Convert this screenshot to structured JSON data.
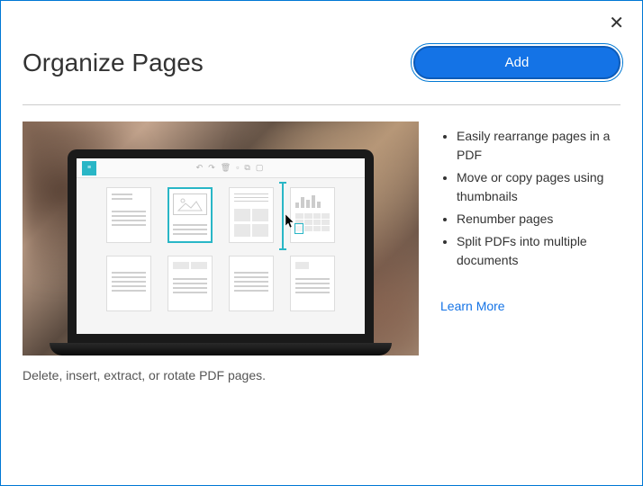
{
  "header": {
    "title": "Organize Pages",
    "add_button": "Add"
  },
  "caption": "Delete, insert, extract, or rotate PDF pages.",
  "features": [
    "Easily rearrange pages in a PDF",
    "Move or copy pages using thumbnails",
    "Renumber pages",
    "Split PDFs into multiple documents"
  ],
  "learn_more": "Learn More",
  "close_label": "✕"
}
